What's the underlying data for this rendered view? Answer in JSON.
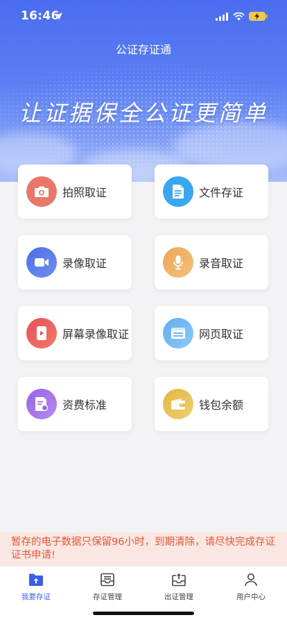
{
  "status_bar": {
    "time": "16:46"
  },
  "header": {
    "title": "公证存证通",
    "slogan": "让证据保全公证更简单"
  },
  "features": [
    {
      "label": "拍照取证",
      "icon": "camera-icon",
      "color": "#e9776a"
    },
    {
      "label": "文件存证",
      "icon": "document-icon",
      "color": "#3aa6f0"
    },
    {
      "label": "录像取证",
      "icon": "video-camera-icon",
      "color": "#5a78ec"
    },
    {
      "label": "录音取证",
      "icon": "microphone-icon",
      "color": "#f0b167"
    },
    {
      "label": "屏幕录像取证",
      "icon": "screen-record-icon",
      "color": "#ec6062"
    },
    {
      "label": "网页取证",
      "icon": "webpage-icon",
      "color": "#7bbdf3"
    },
    {
      "label": "资费标准",
      "icon": "fee-document-icon",
      "color": "#a675e8"
    },
    {
      "label": "钱包余额",
      "icon": "wallet-icon",
      "color": "#e8c65a"
    }
  ],
  "notice": {
    "text": "暂存的电子数据只保留96小时，到期清除，请尽快完成存证证书申请!"
  },
  "tabbar": {
    "tabs": [
      {
        "label": "我要存证",
        "icon": "upload-folder-icon",
        "active": true
      },
      {
        "label": "存证管理",
        "icon": "inbox-list-icon",
        "active": false
      },
      {
        "label": "出证管理",
        "icon": "outbox-icon",
        "active": false
      },
      {
        "label": "用户中心",
        "icon": "user-icon",
        "active": false
      }
    ]
  }
}
